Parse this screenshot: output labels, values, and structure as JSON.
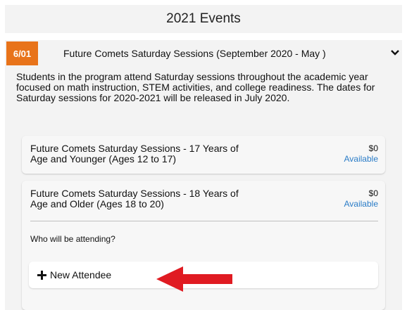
{
  "page": {
    "title": "2021 Events"
  },
  "event": {
    "date": "6/01",
    "title": "Future Comets Saturday Sessions (September 2020 - May )",
    "description": "Students in the program attend Saturday sessions throughout the academic year focused on math instruction, STEM activities, and college readiness. The dates for Saturday sessions for 2020-2021 will be released in July 2020."
  },
  "options": [
    {
      "title": "Future Comets Saturday Sessions - 17 Years of Age and Younger (Ages 12 to 17)",
      "price": "$0",
      "status": "Available"
    },
    {
      "title": "Future Comets Saturday Sessions - 18 Years of Age and Older (Ages 18 to 20)",
      "price": "$0",
      "status": "Available"
    }
  ],
  "attendance": {
    "question": "Who will be attending?",
    "new_attendee_label": "New Attendee"
  },
  "colors": {
    "badge": "#e8731a",
    "link": "#2a7cc7",
    "arrow": "#e01b22"
  },
  "icons": {
    "expand": "chevron-down-icon",
    "add": "plus-icon",
    "annotation": "red-arrow"
  }
}
